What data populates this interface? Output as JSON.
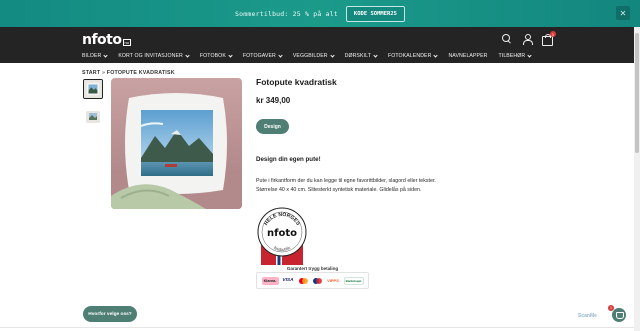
{
  "promo": {
    "text": "Sommertilbud: 25 % på alt",
    "code_label": "KODE SOMMER25",
    "close_label": "✕"
  },
  "header": {
    "logo_text": "nfoto",
    "logo_tag": "no",
    "cart_count": "1"
  },
  "nav": {
    "items": [
      "BILDER",
      "KORT OG INVITASJONER",
      "FOTOBOK",
      "FOTOGAVER",
      "VEGGBILDER",
      "DØRSKILT",
      "FOTOKALENDER",
      "NAVNELAPPER",
      "TILBEHØR"
    ]
  },
  "breadcrumb": {
    "home": "START",
    "separator": "»",
    "current": "FOTOPUTE KVADRATISK"
  },
  "product": {
    "title": "Fotopute kvadratisk",
    "price": "kr 349,00",
    "design_button": "Design",
    "subheading": "Design din egen pute!",
    "description": [
      "Pute i firkantform der du kan legge til egne favorittbilder, slagord eller tekster.",
      "Størrelse 40 x 40 cm. Slitesterkt syntetisk materiale. Glidelås på siden."
    ]
  },
  "badge": {
    "top_text": "HELE NORGES",
    "logo": "nfoto",
    "bottom_text": "fotobutikk"
  },
  "payment": {
    "label": "Garantert trygg betaling",
    "methods": [
      "Klarna",
      "VISA",
      "Mastercard",
      "Maestro",
      "Vipps",
      "Bankaxept"
    ],
    "klarna": "Klarna.",
    "visa": "VISA",
    "vipps": "VIPPS",
    "bank": "BankAxept"
  },
  "footer": {
    "why_button": "Hvorfor velge oss?",
    "chat_count": "1",
    "watermark": "ScanMe"
  },
  "colors": {
    "promo_bg": "#1b9a8a",
    "header_bg": "#242424",
    "accent": "#4f7e75",
    "badge_red": "#d63a3a"
  }
}
